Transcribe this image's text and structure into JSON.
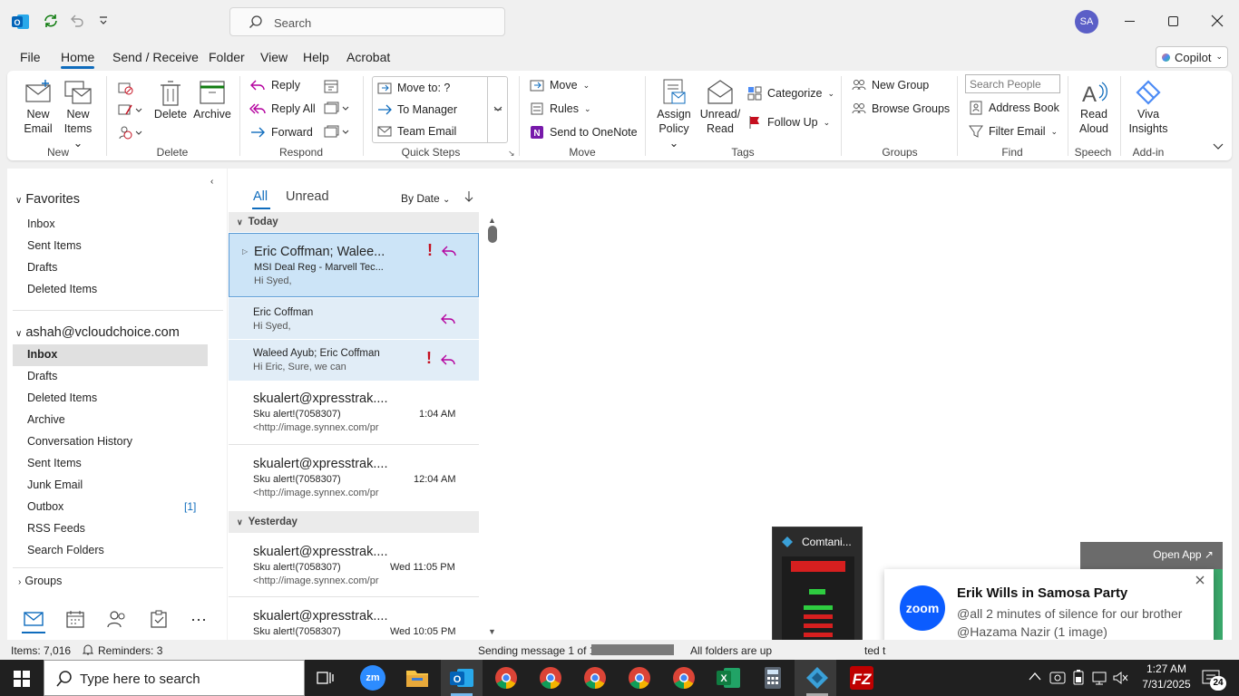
{
  "titlebar": {
    "search_placeholder": "Search",
    "avatar": "SA"
  },
  "menu": [
    {
      "label": "File"
    },
    {
      "label": "Home"
    },
    {
      "label": "Send / Receive"
    },
    {
      "label": "Folder"
    },
    {
      "label": "View"
    },
    {
      "label": "Help"
    },
    {
      "label": "Acrobat"
    }
  ],
  "copilot": "Copilot",
  "ribbon": {
    "new_email": [
      "New",
      "Email"
    ],
    "new_items": [
      "New",
      "Items"
    ],
    "delete": "Delete",
    "archive": "Archive",
    "reply": "Reply",
    "reply_all": "Reply All",
    "forward": "Forward",
    "qs_move_to": "Move to: ?",
    "qs_to_manager": "To Manager",
    "qs_team_email": "Team Email",
    "move": "Move",
    "rules": "Rules",
    "send_onenote": "Send to OneNote",
    "assign_policy": [
      "Assign",
      "Policy"
    ],
    "unread_read": [
      "Unread/",
      "Read"
    ],
    "categorize": "Categorize",
    "follow_up": "Follow Up",
    "new_group": "New Group",
    "browse_groups": "Browse Groups",
    "search_people": "Search People",
    "address_book": "Address Book",
    "filter_email": "Filter Email",
    "read_aloud": [
      "Read",
      "Aloud"
    ],
    "viva": [
      "Viva",
      "Insights"
    ],
    "groups": [
      "New",
      "Delete",
      "Respond",
      "Quick Steps",
      "Move",
      "Tags",
      "Groups",
      "Find",
      "Speech",
      "Add-in"
    ]
  },
  "nav": {
    "favorites": "Favorites",
    "fav_items": [
      "Inbox",
      "Sent Items",
      "Drafts",
      "Deleted Items"
    ],
    "account": "ashah@vcloudchoice.com",
    "account_items": [
      "Inbox",
      "Drafts",
      "Deleted Items",
      "Archive",
      "Conversation History",
      "Sent Items",
      "Junk Email",
      "Outbox",
      "RSS Feeds",
      "Search Folders"
    ],
    "outbox_count": "[1]",
    "groups": "Groups"
  },
  "list": {
    "tab_all": "All",
    "tab_unread": "Unread",
    "sort": "By Date",
    "today": "Today",
    "yesterday": "Yesterday",
    "messages": [
      {
        "from": "Eric Coffman;  Walee...",
        "subject": "MSI Deal Reg - Marvell Tec...",
        "preview": "Hi Syed,",
        "time": ""
      },
      {
        "from": "Eric Coffman",
        "subject": "",
        "preview": "Hi Syed,",
        "time": ""
      },
      {
        "from": "Waleed Ayub;  Eric Coffman",
        "subject": "",
        "preview": "Hi Eric,   Sure, we can",
        "time": ""
      },
      {
        "from": "skualert@xpresstrak....",
        "subject": "Sku alert!(7058307)",
        "preview": "<http://image.synnex.com/pr",
        "time": "1:04 AM"
      },
      {
        "from": "skualert@xpresstrak....",
        "subject": "Sku alert!(7058307)",
        "preview": "<http://image.synnex.com/pr",
        "time": "12:04 AM"
      },
      {
        "from": "skualert@xpresstrak....",
        "subject": "Sku alert!(7058307)",
        "preview": "<http://image.synnex.com/pr",
        "time": "Wed 11:05 PM"
      },
      {
        "from": "skualert@xpresstrak....",
        "subject": "Sku alert!(7058307)",
        "preview": "",
        "time": "Wed 10:05 PM"
      }
    ]
  },
  "status": {
    "items": "Items: 7,016",
    "reminders": "Reminders: 3",
    "sending": "Sending message 1 of 1",
    "folders": "All folders are up",
    "partial": "ted t"
  },
  "thumb": {
    "title": "Comtani..."
  },
  "openapp": "Open App ↗",
  "toast": {
    "title": "Erik Wills in Samosa Party",
    "body": "@all 2 minutes of silence for our brother @Hazama Nazir (1 image)",
    "logo": "zoom"
  },
  "taskbar": {
    "search": "Type here to search",
    "time": "1:27 AM",
    "date": "7/31/2025",
    "notif": "24"
  },
  "colors": {
    "accent": "#0f6cbd",
    "selected": "#cce4f7",
    "flag": "#c50f1f",
    "reply": "#b4009e"
  }
}
